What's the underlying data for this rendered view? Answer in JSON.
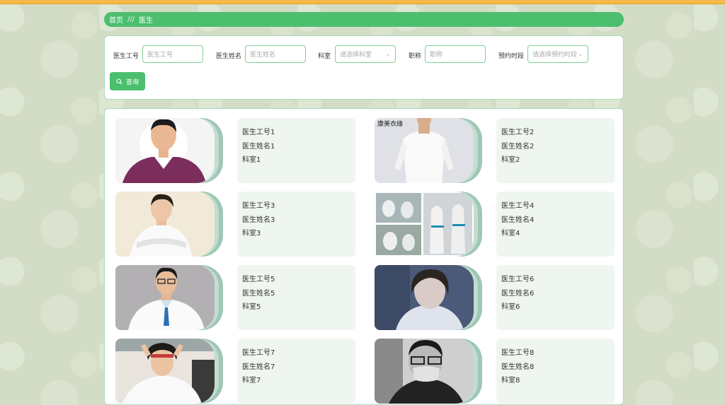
{
  "breadcrumb": {
    "home": "首页",
    "separator": "///",
    "current": "医生"
  },
  "search": {
    "fields": [
      {
        "label": "医生工号",
        "placeholder": "医生工号",
        "type": "text"
      },
      {
        "label": "医生姓名",
        "placeholder": "医生姓名",
        "type": "text"
      },
      {
        "label": "科室",
        "placeholder": "请选择科室",
        "type": "select"
      },
      {
        "label": "职称",
        "placeholder": "职称",
        "type": "text"
      },
      {
        "label": "预约时段",
        "placeholder": "请选择预约时段",
        "type": "select"
      }
    ],
    "query_button": "查询",
    "query_icon": "search-icon"
  },
  "doctors": [
    {
      "id": "医生工号1",
      "name": "医生姓名1",
      "dept": "科室1",
      "photo": "doctor-in-purple-scrubs"
    },
    {
      "id": "医生工号2",
      "name": "医生姓名2",
      "dept": "科室2",
      "photo": "white-coat-uniform",
      "photo_text": "康美衣緣"
    },
    {
      "id": "医生工号3",
      "name": "医生姓名3",
      "dept": "科室3",
      "photo": "female-doctor-arms-crossed"
    },
    {
      "id": "医生工号4",
      "name": "医生姓名4",
      "dept": "科室4",
      "photo": "protective-suit-collage"
    },
    {
      "id": "医生工号5",
      "name": "医生姓名5",
      "dept": "科室5",
      "photo": "male-doctor-glasses"
    },
    {
      "id": "医生工号6",
      "name": "医生姓名6",
      "dept": "科室6",
      "photo": "tired-female-doctor"
    },
    {
      "id": "医生工号7",
      "name": "医生姓名7",
      "dept": "科室7",
      "photo": "smiling-nurse"
    },
    {
      "id": "医生工号8",
      "name": "医生姓名8",
      "dept": "科室8",
      "photo": "doctor-with-mask-bw"
    }
  ],
  "colors": {
    "accent": "#4cbf6f",
    "topbar": "#f3b94a",
    "info_bg": "#eff6f0",
    "border": "#a9dbb8"
  }
}
